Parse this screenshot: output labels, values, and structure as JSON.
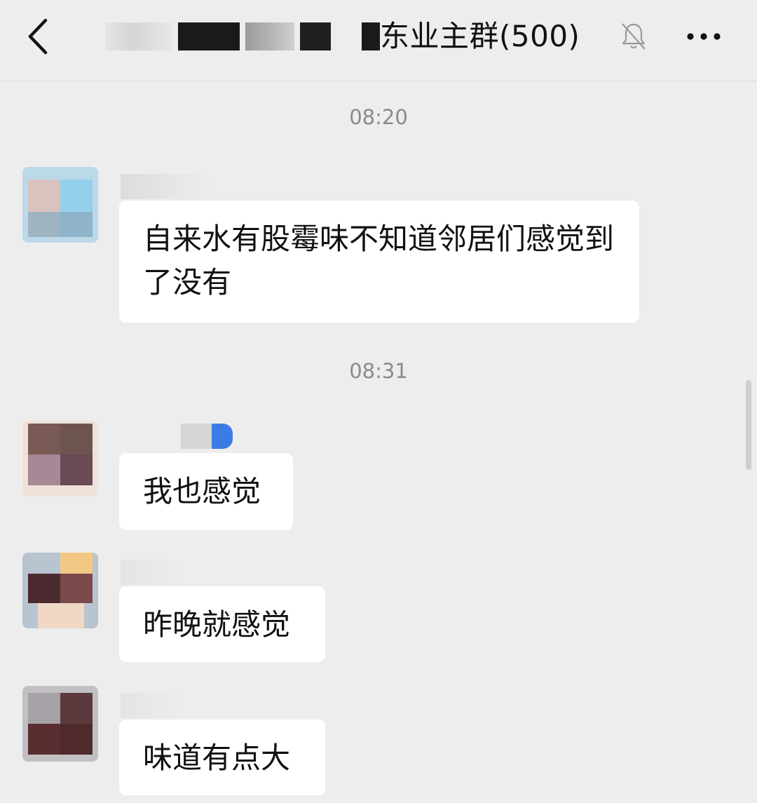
{
  "header": {
    "title": "东业主群(500)",
    "back_icon": "chevron-left-icon",
    "mute_icon": "bell-muted-icon",
    "more_icon": "more-dots-icon"
  },
  "messages": [
    {
      "time": "08:20",
      "text": "自来水有股霉味不知道邻居们感觉到了没有"
    },
    {
      "time": "08:31",
      "text": "我也感觉"
    },
    {
      "text": "昨晚就感觉"
    },
    {
      "text": "味道有点大"
    }
  ],
  "colors": {
    "background": "#ededed",
    "bubble": "#ffffff",
    "timestamp": "#8a8a8a"
  }
}
